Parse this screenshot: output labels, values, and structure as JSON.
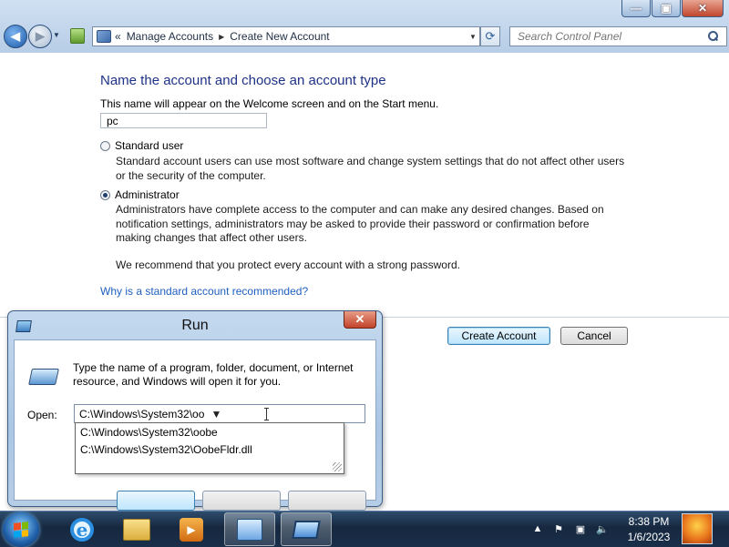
{
  "window": {
    "controls": {
      "minimize": "—",
      "maximize": "▣",
      "close": "✕"
    }
  },
  "nav": {
    "breadcrumb": {
      "prefix": "«",
      "items": [
        "Manage Accounts",
        "Create New Account"
      ]
    },
    "search_placeholder": "Search Control Panel"
  },
  "main": {
    "heading": "Name the account and choose an account type",
    "subtext": "This name will appear on the Welcome screen and on the Start menu.",
    "account_name": "pc",
    "standard": {
      "label": "Standard user",
      "description": "Standard account users can use most software and change system settings that do not affect other users or the security of the computer.",
      "selected": false
    },
    "administrator": {
      "label": "Administrator",
      "description": "Administrators have complete access to the computer and can make any desired changes. Based on notification settings, administrators may be asked to provide their password or confirmation before making changes that affect other users.",
      "recommendation": "We recommend that you protect every account with a strong password.",
      "selected": true
    },
    "link": "Why is a standard account recommended?",
    "create_button": "Create Account",
    "cancel_button": "Cancel"
  },
  "run_dialog": {
    "title": "Run",
    "close": "✕",
    "message": "Type the name of a program, folder, document, or Internet resource, and Windows will open it for you.",
    "open_label": "Open:",
    "open_value": "C:\\Windows\\System32\\oo",
    "suggestions": [
      "C:\\Windows\\System32\\oobe",
      "C:\\Windows\\System32\\OobeFldr.dll"
    ]
  },
  "taskbar": {
    "apps": [
      "internet-explorer-icon",
      "windows-explorer-icon",
      "media-player-icon",
      "control-panel-icon",
      "run-icon"
    ],
    "time": "8:38 PM",
    "date": "1/6/2023"
  },
  "colors": {
    "heading": "#1e3287",
    "link": "#1f5fbf",
    "taskbar": "#16283f",
    "flag": [
      "#f25022",
      "#7fba00",
      "#00a4ef",
      "#ffb900"
    ]
  }
}
